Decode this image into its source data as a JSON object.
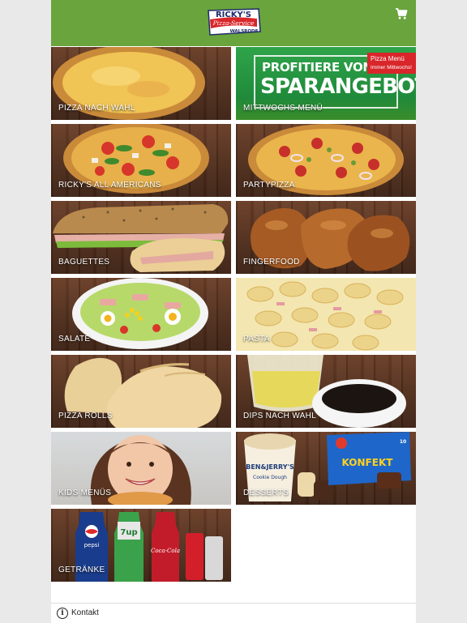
{
  "header": {
    "logo": {
      "line1": "RICKY'S",
      "line2": "Pizza-Service",
      "line3": "WALSRODE"
    },
    "cart_icon": "cart-icon",
    "color": "#6aa43c"
  },
  "tiles": [
    {
      "id": "pizza-nach-wahl",
      "label": "PIZZA NACH WAHL"
    },
    {
      "id": "mittwochs-menu",
      "label": "MITTWOCHS MENÜ",
      "promo": {
        "line1": "PROFITIERE VON UNSE",
        "line2": "SPARANGEBOTEN",
        "badge_title": "Pizza Menü",
        "badge_sub": "Immer Mittwochs!"
      }
    },
    {
      "id": "rickys-all-americans",
      "label": "RICKY'S ALL AMERICANS"
    },
    {
      "id": "partypizza",
      "label": "PARTYPIZZA"
    },
    {
      "id": "baguettes",
      "label": "BAGUETTES"
    },
    {
      "id": "fingerfood",
      "label": "FINGERFOOD"
    },
    {
      "id": "salate",
      "label": "SALATE"
    },
    {
      "id": "pasta",
      "label": "PASTA"
    },
    {
      "id": "pizza-rolls",
      "label": "PIZZA ROLLS"
    },
    {
      "id": "dips-nach-wahl",
      "label": "DIPS NACH WAHL"
    },
    {
      "id": "kids-menus",
      "label": "KIDS MENÜS"
    },
    {
      "id": "desserts",
      "label": "DESSERTS",
      "product_text": {
        "ice_brand": "BEN&JERRY'S",
        "ice_flavor": "Cookie Dough",
        "box": "KONFEKT",
        "box_count": "10"
      }
    },
    {
      "id": "getraenke",
      "label": "GETRÄNKE",
      "product_text": {
        "pepsi": "pepsi",
        "sevenup": "7up",
        "cola": "Coca-Cola"
      }
    }
  ],
  "footer": {
    "info_icon": "info-icon",
    "kontakt": "Kontakt"
  }
}
